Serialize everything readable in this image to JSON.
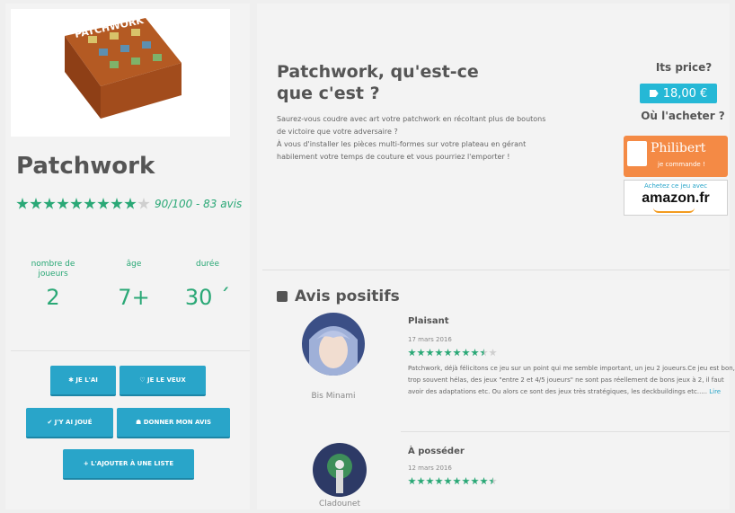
{
  "game": {
    "title": "Patchwork",
    "rating_text": "90/100 - 83 avis",
    "rating_fraction": 0.9,
    "box_logo": "PATCHWORK"
  },
  "stats": [
    {
      "label": "nombre de joueurs",
      "value": "2"
    },
    {
      "label": "âge",
      "value": "7+"
    },
    {
      "label": "durée",
      "value": "30 ´"
    }
  ],
  "buttons": {
    "je_lai": "✱ JE L'AI",
    "je_le_veux": "♡ JE LE VEUX",
    "jy_ai_joue": "✔ J'Y AI JOUÉ",
    "donner_avis": "☗ DONNER MON AVIS",
    "ajouter_liste": "+ L'AJOUTER À UNE LISTE"
  },
  "about": {
    "title": "Patchwork, qu'est-ce que c'est ?",
    "paragraph1": "Saurez-vous coudre avec art votre patchwork en récoltant plus de boutons de victoire que votre adversaire ?",
    "paragraph2": "À vous d'installer les pièces multi-formes sur votre plateau en gérant habilement votre temps de couture et vous pourriez l'emporter !"
  },
  "purchase": {
    "price_question": "Its price?",
    "price": "18,00 €",
    "where_question": "Où l'acheter ?",
    "philibert_name": "Philibert",
    "philibert_sub": "je commande !",
    "amazon_top": "Achetez ce jeu avec",
    "amazon_logo": "amazon.fr"
  },
  "reviews_section": {
    "title": "Avis positifs",
    "reviews": [
      {
        "author": "Bis Minami",
        "title": "Plaisant",
        "date": "17 mars 2016",
        "text": "Patchwork, déjà félicitons ce jeu sur un point qui me semble important, un jeu 2 joueurs.Ce jeu est bon, trop souvent hélas, des jeux \"entre 2 et 4/5 joueurs\" ne sont pas réellement de bons jeux à 2, il faut avoir des adaptations etc. Ou alors ce sont des jeux très stratégiques, les deckbuildings etc.....",
        "more": "Lire"
      },
      {
        "author": "Cladounet",
        "title": "À posséder",
        "date": "12 mars 2016"
      }
    ]
  },
  "colors": {
    "accent_green": "#2aa876",
    "button_blue": "#29a5c9",
    "price_cyan": "#25b8d6",
    "philibert_orange": "#f48a45"
  }
}
